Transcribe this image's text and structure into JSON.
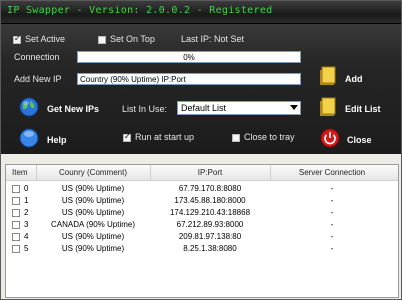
{
  "window": {
    "title": "IP Swapper - Version: 2.0.0.2 - Registered"
  },
  "options": {
    "set_active": "Set Active",
    "set_on_top": "Set On Top",
    "last_ip": "Last IP: Not Set",
    "run_at_startup": "Run at start up",
    "close_to_tray": "Close to tray"
  },
  "connection": {
    "label": "Connection",
    "progress_text": "0%",
    "progress": 0
  },
  "add_ip": {
    "label": "Add New IP",
    "value": "Country (90% Uptime)  IP:Port",
    "button": "Add"
  },
  "buttons": {
    "get_new_ips": "Get New IPs",
    "edit_list": "Edit List",
    "help": "Help",
    "close": "Close"
  },
  "list_in_use": {
    "label": "List In Use:",
    "selected": "Default List"
  },
  "table": {
    "headers": [
      "Item",
      "Counry (Comment)",
      "IP:Port",
      "Server Connection"
    ],
    "rows": [
      {
        "item": "0",
        "country": "US (90% Uptime)",
        "ip": "67.79.170.8:8080",
        "conn": "-"
      },
      {
        "item": "1",
        "country": "US (90% Uptime)",
        "ip": "173.45.88.180:8000",
        "conn": "-"
      },
      {
        "item": "2",
        "country": "US (90% Uptime)",
        "ip": "174.129.210.43:18868",
        "conn": "-"
      },
      {
        "item": "3",
        "country": "CANADA (90% Uptime)",
        "ip": "67.212.89.93:8000",
        "conn": "-"
      },
      {
        "item": "4",
        "country": "US (90% Uptime)",
        "ip": "209.81.97.138:80",
        "conn": "-"
      },
      {
        "item": "5",
        "country": "US (90% Uptime)",
        "ip": "8.25.1.38:8080",
        "conn": "-"
      }
    ]
  },
  "colors": {
    "title_text": "#3fd93f",
    "panel_bg": "#262626",
    "close_red": "#d21a1a",
    "globe_blue": "#2a73d9"
  }
}
